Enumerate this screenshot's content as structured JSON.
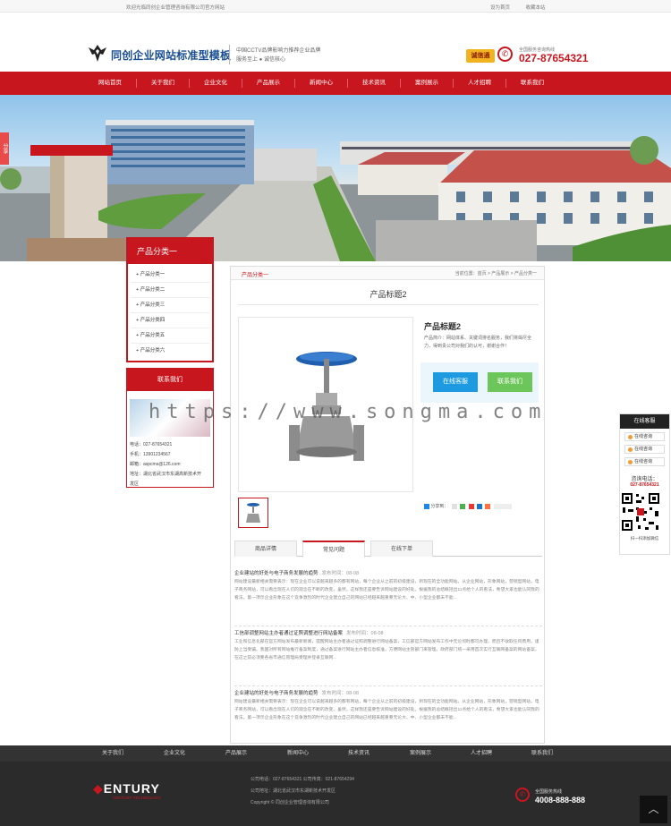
{
  "topbar": {
    "welcome": "欢迎光临同创企业管理咨询有限公司官方网站",
    "set_home": "设为首页",
    "bookmark": "收藏本站"
  },
  "header": {
    "logo_text": "同创企业网站标准型模板",
    "slogan_line1": "中国CCTV品牌影响力推荐企业品牌",
    "slogan_line2": "服务至上 ● 诚信核心",
    "badge": "诚信通",
    "hotline_label": "全国服务咨询热线",
    "hotline": "027-87654321"
  },
  "nav": [
    "网站首页",
    "关于我们",
    "企业文化",
    "产品展示",
    "新闻中心",
    "技术资讯",
    "案例展示",
    "人才招聘",
    "联系我们"
  ],
  "side_tab": "分享",
  "sidebar": {
    "category_title": "产品分类一",
    "categories": [
      "产品分类一",
      "产品分类二",
      "产品分类三",
      "产品分类四",
      "产品分类五",
      "产品分类六"
    ],
    "contact_title": "联系我们",
    "contact_lines": [
      "电话：027-87654321",
      "手机：13901234567",
      "邮箱：aspcms@126.com",
      "地址：湖北省武汉市东湖高新技术开",
      "发区"
    ]
  },
  "main": {
    "crumb_cat": "产品分类一",
    "crumb_path": "当前位置：首页 > 产品展示 > 产品分类一",
    "heading": "产品标题2",
    "product_title": "产品标题2",
    "product_desc": "产品简介：网站体系、关键词排名服务，我们将竭尽全力，得到贵公司对我们的认可，谢谢合作！",
    "btn_kefu": "在线客服",
    "btn_contact": "联系我们",
    "share_label": "分享到：",
    "tabs": [
      "商品详情",
      "常见问题",
      "在线下单"
    ],
    "articles": [
      {
        "title": "企业建站的好处与电子商务发展的趋势",
        "date": "发布时间：08-08",
        "body": "网站建设最新相关需要表示：现在企业可以说越来越多的都有网站，每个企业从之前的初级建设，到现在的全功能网站。从企业网站，形象网站，营销型网站，电子商务网站，可以看出现在人们的观念在不断的改变。虽然，这样我还是要告诉网站建设的好处。根据我的总结概括出11点给个人的看法，希望大家也能认同我的看法。第一项示企业形象在这个竞争激烈的时代企业建立自己的网站已经越来越重要无论大、中、小型企业都未不能..."
      },
      {
        "title": "工信部调整网站主办者通过证照调整进行网站备案",
        "date": "发布时间：08-08",
        "body": "工业和信息化部在官方网站发布最新新闻，提醒网站主办者通过证照调整进行网站备案，工信部官方网站发布工作中无论何时都可办理，而且不收取任何费用，谨防上当受骗。我国对所有网站推行备案制度，通过备案进行网站主办者信息核准，方便网站主管部门来管理。政府部门统一采用首次实行互联网备案的网站备案，在这之前必须要各省市通信管理局受理并登录互联网..."
      },
      {
        "title": "企业建站的好处与电子商务发展的趋势",
        "date": "发布时间：08-08",
        "body": "网站建设最新相关需要表示：现在企业可以说越来越多的都有网站，每个企业从之前的初级建设，到现在的全功能网站。从企业网站，形象网站，营销型网站，电子商务网站，可以看出现在人们的观念在不断的改变。虽然，这样我还是要告诉网站建设的好处。根据我的总结概括出11点给个人的看法，希望大家也能认同我的看法。第一项示企业形象在这个竞争激烈的时代企业建立自己的网站已经越来越重要无论大、中、小型企业都未不能..."
      }
    ]
  },
  "footer": {
    "nav": [
      "关于我们",
      "企业文化",
      "产品展示",
      "新闻中心",
      "技术资讯",
      "案例展示",
      "人才招聘",
      "联系我们"
    ],
    "logo": "ENTURY",
    "logo_sub": "CENTURY TECHNOLOGY",
    "info_line1": "公司电话：027-87654321  公司传真：021-87654294",
    "info_line2": "公司地址：湖北省武汉市东湖新技术开发区",
    "info_line3": "Copyright © 同创企业管理咨询有限公司",
    "hotline_label": "全国服务热线",
    "hotline": "4008-888-888"
  },
  "float_panel": {
    "title": "在线客服",
    "buttons": [
      "在线咨询",
      "在线咨询",
      "在线咨询"
    ],
    "phone_label": "咨询电话：",
    "phone": "027-87654321",
    "scan": "扫一扫添加微信"
  },
  "watermark": "https://www.songma.com",
  "colors": {
    "brand_red": "#c8161e",
    "blue_button": "#1e9be0",
    "green_button": "#6cc65a"
  }
}
